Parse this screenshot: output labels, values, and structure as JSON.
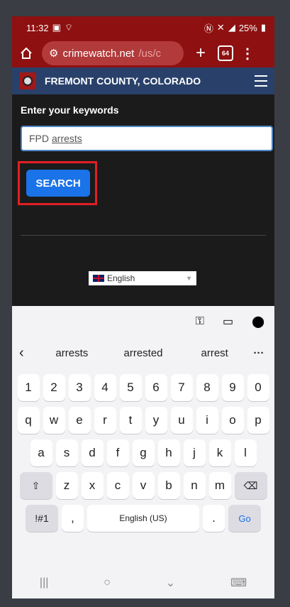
{
  "status": {
    "time": "11:32",
    "battery": "25%"
  },
  "browser": {
    "url_main": "crimewatch.net",
    "url_tail": "/us/c",
    "tab_count": "64"
  },
  "site": {
    "title": "FREMONT COUNTY, COLORADO"
  },
  "search": {
    "label": "Enter your keywords",
    "value_prefix": "FPD",
    "value_word": "arrests",
    "button_label": "SEARCH"
  },
  "language": {
    "selected": "English"
  },
  "keyboard": {
    "suggestions": [
      "arrests",
      "arrested",
      "arrest"
    ],
    "numbers": [
      "1",
      "2",
      "3",
      "4",
      "5",
      "6",
      "7",
      "8",
      "9",
      "0"
    ],
    "row1": [
      "q",
      "w",
      "e",
      "r",
      "t",
      "y",
      "u",
      "i",
      "o",
      "p"
    ],
    "row2": [
      "a",
      "s",
      "d",
      "f",
      "g",
      "h",
      "j",
      "k",
      "l"
    ],
    "row3": [
      "z",
      "x",
      "c",
      "v",
      "b",
      "n",
      "m"
    ],
    "symbols_label": "!#1",
    "comma": ",",
    "space_label": "English (US)",
    "period": ".",
    "go_label": "Go"
  },
  "colors": {
    "browser_bar": "#8e1010",
    "site_header": "#29416a",
    "search_button": "#1a73e8",
    "highlight": "#e31e24"
  }
}
